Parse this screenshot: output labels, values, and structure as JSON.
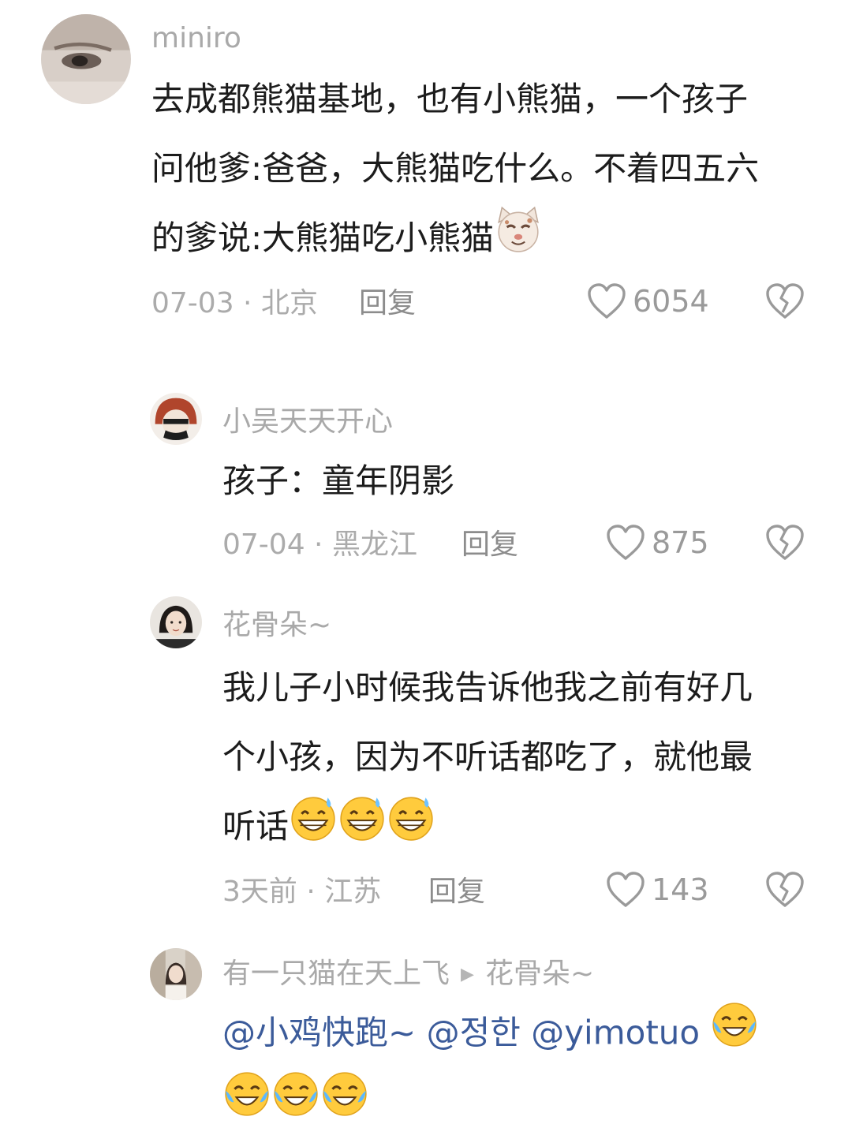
{
  "comments": [
    {
      "username": "miniro",
      "lines": [
        "去成都熊猫基地，也有小熊猫，一个孩子",
        "问他爹:爸爸，大熊猫吃什么。不着四五六",
        "的爹说:大熊猫吃小熊猫"
      ],
      "emoji": "cat-face-emoji",
      "date_location": "07-03 · 北京",
      "reply_label": "回复",
      "likes": "6054"
    },
    {
      "username": "小吴天天开心",
      "lines": [
        "孩子：童年阴影"
      ],
      "date_location": "07-04 · 黑龙江",
      "reply_label": "回复",
      "likes": "875"
    },
    {
      "username": "花骨朵~",
      "lines": [
        "我儿子小时候我告诉他我之前有好几",
        "个小孩，因为不听话都吃了，就他最",
        "听话"
      ],
      "emoji": "grinning-sweat-emoji",
      "date_location": "3天前 · 江苏",
      "reply_label": "回复",
      "likes": "143"
    },
    {
      "username": "有一只猫在天上飞",
      "reply_to": "花骨朵~",
      "mentions": [
        "@小鸡快跑~",
        "@정한",
        "@yimotuo"
      ],
      "emoji": "crying-laughing-emoji"
    }
  ],
  "colors": {
    "mention": "#3b5b9a",
    "meta": "#ababab",
    "text": "#1c1c1c"
  }
}
